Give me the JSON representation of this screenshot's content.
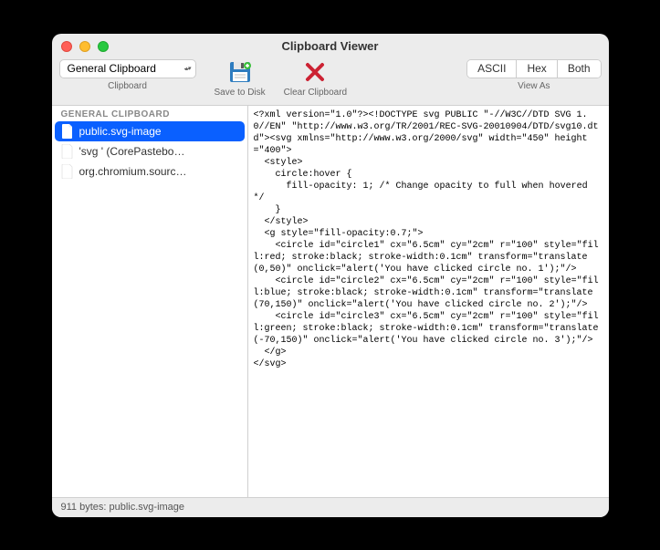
{
  "window": {
    "title": "Clipboard Viewer"
  },
  "toolbar": {
    "clipboard_select": "General Clipboard",
    "clipboard_label": "Clipboard",
    "save_label": "Save to Disk",
    "clear_label": "Clear Clipboard",
    "viewas_label": "View As",
    "seg_ascii": "ASCII",
    "seg_hex": "Hex",
    "seg_both": "Both"
  },
  "sidebar": {
    "header": "GENERAL CLIPBOARD",
    "items": [
      {
        "label": "public.svg-image",
        "selected": true
      },
      {
        "label": "'svg ' (CorePastebo…",
        "selected": false
      },
      {
        "label": "org.chromium.sourc…",
        "selected": false
      }
    ]
  },
  "content": "<?xml version=\"1.0\"?><!DOCTYPE svg PUBLIC \"-//W3C//DTD SVG 1.0//EN\" \"http://www.w3.org/TR/2001/REC-SVG-20010904/DTD/svg10.dtd\"><svg xmlns=\"http://www.w3.org/2000/svg\" width=\"450\" height=\"400\">\n  <style>\n    circle:hover {\n      fill-opacity: 1; /* Change opacity to full when hovered */\n    }\n  </style>\n  <g style=\"fill-opacity:0.7;\">\n    <circle id=\"circle1\" cx=\"6.5cm\" cy=\"2cm\" r=\"100\" style=\"fill:red; stroke:black; stroke-width:0.1cm\" transform=\"translate(0,50)\" onclick=\"alert('You have clicked circle no. 1');\"/>\n    <circle id=\"circle2\" cx=\"6.5cm\" cy=\"2cm\" r=\"100\" style=\"fill:blue; stroke:black; stroke-width:0.1cm\" transform=\"translate(70,150)\" onclick=\"alert('You have clicked circle no. 2');\"/>\n    <circle id=\"circle3\" cx=\"6.5cm\" cy=\"2cm\" r=\"100\" style=\"fill:green; stroke:black; stroke-width:0.1cm\" transform=\"translate(-70,150)\" onclick=\"alert('You have clicked circle no. 3');\"/>\n  </g>\n</svg>",
  "statusbar": {
    "text": "911 bytes: public.svg-image"
  }
}
